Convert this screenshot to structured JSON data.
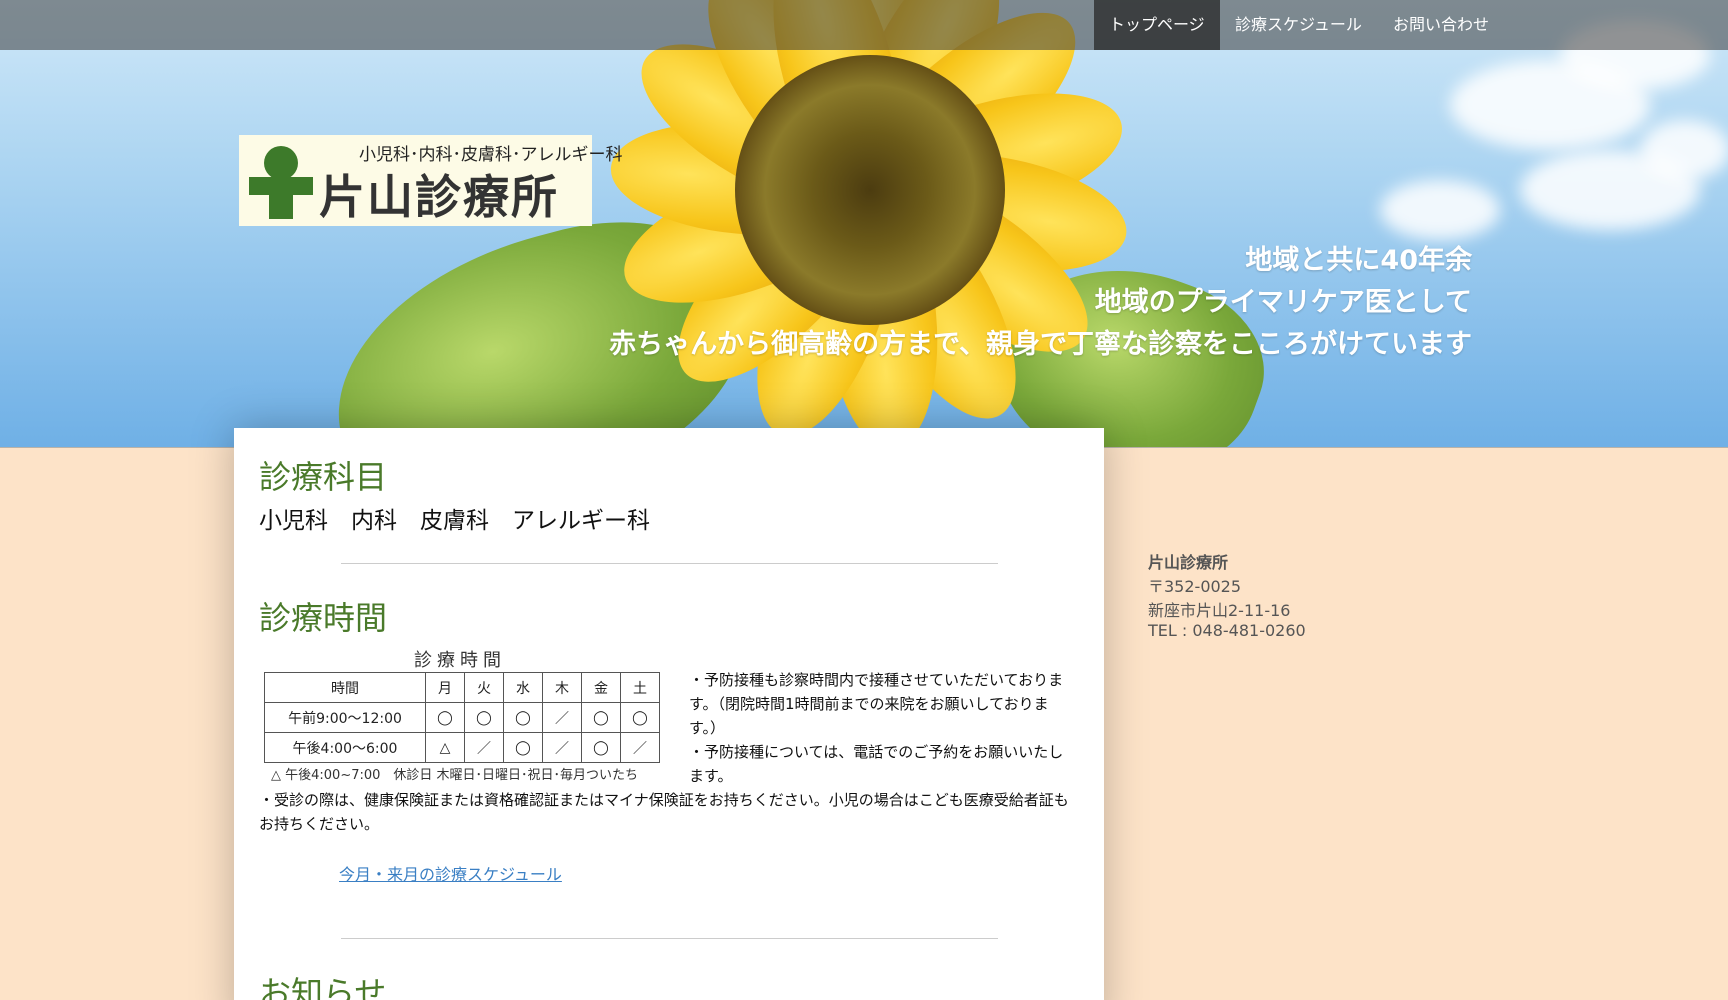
{
  "nav": {
    "items": [
      {
        "label": "トップページ",
        "active": true
      },
      {
        "label": "診療スケジュール",
        "active": false
      },
      {
        "label": "お問い合わせ",
        "active": false
      }
    ]
  },
  "logo": {
    "subtitle": "小児科･内科･皮膚科･アレルギー科",
    "name": "片山診療所"
  },
  "tagline": {
    "line1": "地域と共に40年余",
    "line2": "地域のプライマリケア医として",
    "line3": "赤ちゃんから御高齢の方まで、親身で丁寧な診察をこころがけています"
  },
  "departments": {
    "heading": "診療科目",
    "list": "小児科　内科　皮膚科　アレルギー科"
  },
  "hours": {
    "heading": "診療時間",
    "table_title": "診療時間",
    "columns": [
      "時間",
      "月",
      "火",
      "水",
      "木",
      "金",
      "土"
    ],
    "rows": [
      [
        "午前9:00～12:00",
        "◯",
        "◯",
        "◯",
        "／",
        "◯",
        "◯"
      ],
      [
        "午後4:00～6:00",
        "△",
        "／",
        "◯",
        "／",
        "◯",
        "／"
      ]
    ],
    "table_footnote": "△ 午後4:00~7:00　休診日 木曜日･日曜日･祝日･毎月ついたち",
    "note1": "・予防接種も診察時間内で接種させていただいております。（閉院時間1時間前までの来院をお願いしております。）",
    "note2": "・予防接種については、電話でのご予約をお願いいたします。",
    "note3": "・受診の際は、健康保険証または資格確認証またはマイナ保険証をお持ちください。小児の場合はこども医療受給者証もお持ちください。",
    "schedule_link": "今月・来月の診療スケジュール"
  },
  "news": {
    "heading": "お知らせ"
  },
  "sidebar": {
    "clinic_name": "片山診療所",
    "postal": "〒352-0025",
    "address": "新座市片山2-11-16",
    "tel": "TEL : 048-481-0260"
  }
}
